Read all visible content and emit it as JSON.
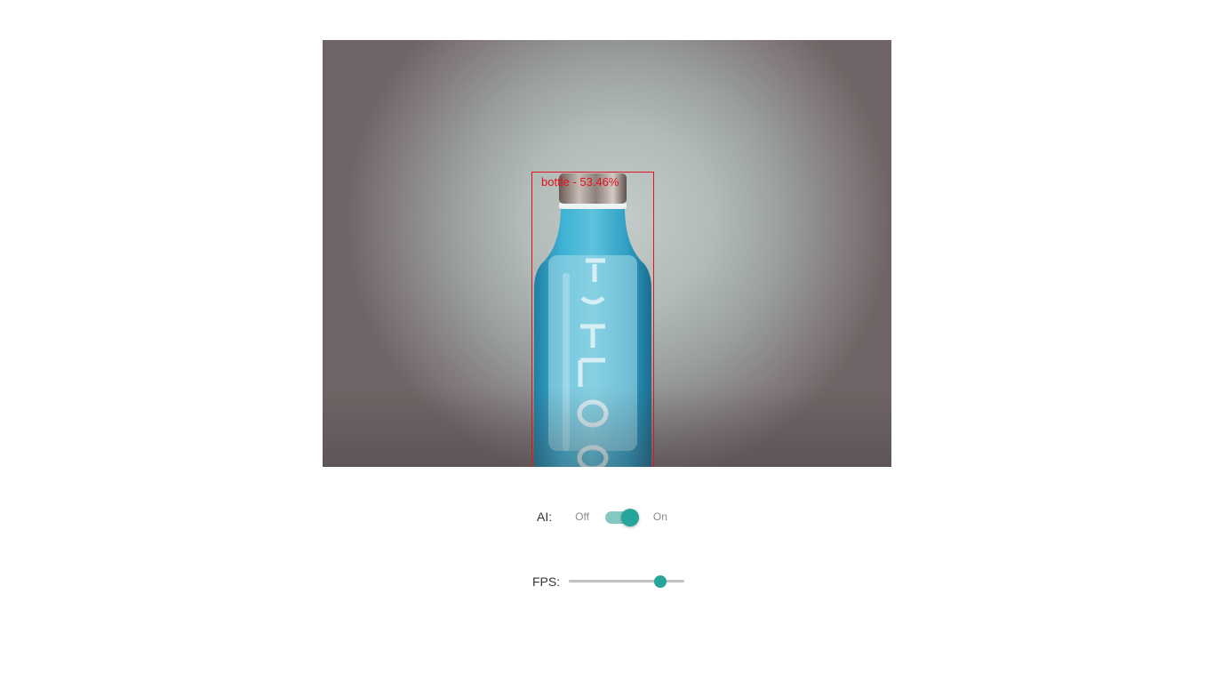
{
  "video": {
    "detection": {
      "label": "bottle - 53.46%",
      "box_color": "#e0141c"
    }
  },
  "ai_toggle": {
    "label": "AI:",
    "off_text": "Off",
    "on_text": "On",
    "checked": true,
    "accent_color": "#26a69a"
  },
  "fps": {
    "label": "FPS:",
    "slider_fraction": 0.79,
    "accent_color": "#26a69a"
  }
}
